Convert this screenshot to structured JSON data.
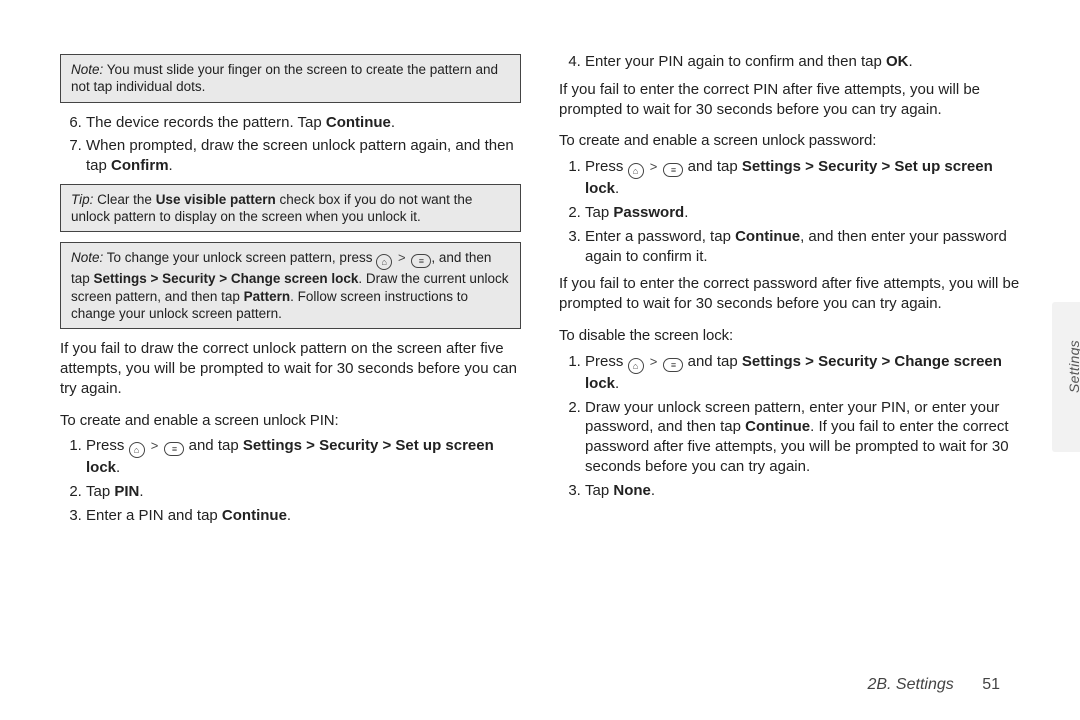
{
  "left": {
    "note1": {
      "label": "Note:",
      "body_a": "You must slide your finger on the screen to create the pattern and not tap individual dots."
    },
    "ol1_start": 6,
    "ol1": {
      "i6_a": "The device records the pattern. Tap ",
      "i6_b": "Continue",
      "i6_c": ".",
      "i7_a": "When prompted, draw the screen unlock pattern again, and then tap ",
      "i7_b": "Confirm",
      "i7_c": "."
    },
    "tip": {
      "label": "Tip:",
      "body_a": "Clear the ",
      "body_b": "Use visible pattern",
      "body_c": " check box if you do not want the unlock pattern to display on the screen when you unlock it."
    },
    "note2": {
      "label": "Note:",
      "body_a": "To change your unlock screen pattern, press ",
      "body_b": ", and then tap ",
      "body_c": "Settings > Security > Change screen lock",
      "body_d": ". Draw the current unlock screen pattern, and then tap ",
      "body_e": "Pattern",
      "body_f": ". Follow screen instructions to change your unlock screen pattern."
    },
    "para_fail": "If you fail to draw the correct unlock pattern on the screen after five attempts, you will be prompted to wait for 30 seconds before you can try again.",
    "subhead_pin": "To create and enable a screen unlock PIN:",
    "pin": {
      "i1_a": "Press ",
      "i1_b": " and tap ",
      "i1_c": "Settings > Security > Set up screen lock",
      "i1_d": ".",
      "i2_a": "Tap ",
      "i2_b": "PIN",
      "i2_c": ".",
      "i3_a": "Enter a PIN and tap ",
      "i3_b": "Continue",
      "i3_c": "."
    }
  },
  "right": {
    "ol_cont_start": 4,
    "i4_a": "Enter your PIN again to confirm and then tap ",
    "i4_b": "OK",
    "i4_c": ".",
    "para_failpin": "If you fail to enter the correct PIN after five attempts, you will be prompted to wait for 30 seconds before you can try again.",
    "subhead_pw": "To create and enable a screen unlock password:",
    "pw": {
      "i1_a": "Press ",
      "i1_b": " and tap ",
      "i1_c": "Settings > Security > Set up screen lock",
      "i1_d": ".",
      "i2_a": "Tap ",
      "i2_b": "Password",
      "i2_c": ".",
      "i3_a": "Enter a password, tap ",
      "i3_b": "Continue",
      "i3_c": ", and then enter your password again to confirm it."
    },
    "para_failpw": "If you fail to enter the correct password after five attempts, you will be prompted to wait for 30 seconds before you can try again.",
    "subhead_disable": "To disable the screen lock:",
    "dis": {
      "i1_a": "Press ",
      "i1_b": " and tap ",
      "i1_c": "Settings > Security > Change screen lock",
      "i1_d": ".",
      "i2_a": "Draw your unlock screen pattern, enter your PIN, or enter your password, and then tap ",
      "i2_b": "Continue",
      "i2_c": ". If you fail to enter the correct password after five attempts, you will be prompted to wait for 30 seconds before you can try again.",
      "i3_a": "Tap ",
      "i3_b": "None",
      "i3_c": "."
    }
  },
  "icons": {
    "home_glyph": "⌂",
    "menu_glyph": "≡",
    "gt": ">"
  },
  "tab": "Settings",
  "footer": {
    "section": "2B. Settings",
    "page": "51"
  }
}
